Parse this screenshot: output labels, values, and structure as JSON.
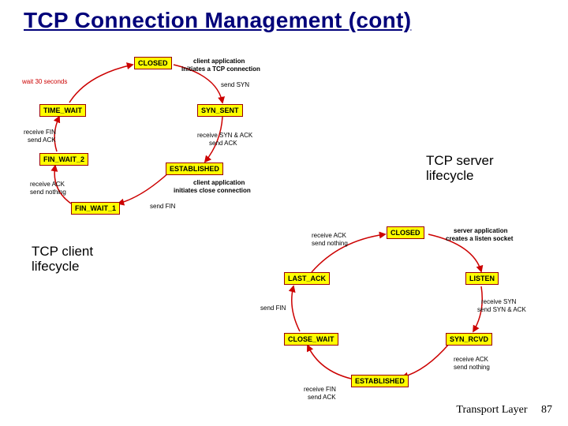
{
  "slide": {
    "title": "TCP Connection Management (cont)",
    "footer_text": "Transport Layer",
    "page_number": "87",
    "caption_server": "TCP server\nlifecycle",
    "caption_client": "TCP client\nlifecycle"
  },
  "client_diagram": {
    "states": {
      "closed": "CLOSED",
      "syn_sent": "SYN_SENT",
      "established": "ESTABLISHED",
      "fin_wait_1": "FIN_WAIT_1",
      "fin_wait_2": "FIN_WAIT_2",
      "time_wait": "TIME_WAIT"
    },
    "labels": {
      "init1": "client application",
      "init2": "initiates a TCP connection",
      "send_syn": "send SYN",
      "recv_synack1": "receive SYN & ACK",
      "recv_synack2": "send ACK",
      "close1": "client application",
      "close2": "initiates close connection",
      "send_fin": "send FIN",
      "recv_ack1": "receive ACK",
      "recv_ack2": "send nothing",
      "recv_fin1": "receive FIN",
      "recv_fin2": "send ACK",
      "wait30": "wait 30 seconds"
    }
  },
  "server_diagram": {
    "states": {
      "closed": "CLOSED",
      "listen": "LISTEN",
      "syn_rcvd": "SYN_RCVD",
      "established": "ESTABLISHED",
      "close_wait": "CLOSE_WAIT",
      "last_ack": "LAST_ACK"
    },
    "labels": {
      "init1": "server application",
      "init2": "creates a listen socket",
      "recv_syn1": "receive SYN",
      "recv_syn2": "send SYN & ACK",
      "recv_ack1": "receive ACK",
      "recv_ack2": "send nothing",
      "recv_fin1": "receive FIN",
      "recv_fin2": "send ACK",
      "send_fin": "send FIN",
      "recv_ack3": "receive ACK",
      "recv_ack4": "send nothing"
    }
  }
}
